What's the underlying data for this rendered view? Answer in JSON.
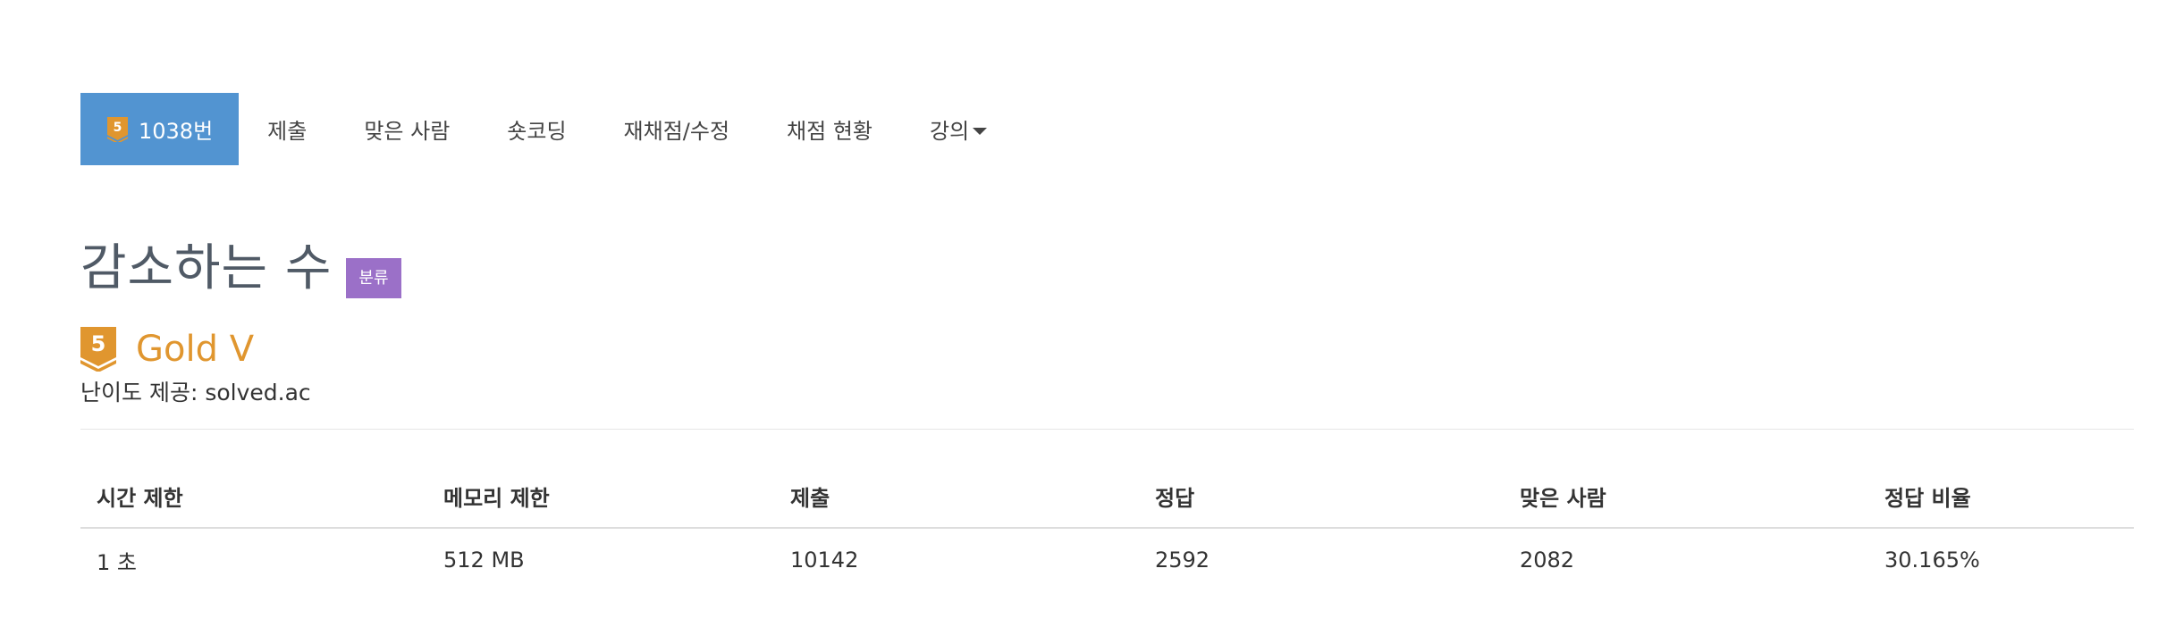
{
  "tabs": [
    {
      "label": "1038번",
      "active": true,
      "badge_tier": "5"
    },
    {
      "label": "제출"
    },
    {
      "label": "맞은 사람"
    },
    {
      "label": "숏코딩"
    },
    {
      "label": "재채점/수정"
    },
    {
      "label": "채점 현황"
    },
    {
      "label": "강의",
      "dropdown": true
    }
  ],
  "problem": {
    "title": "감소하는 수",
    "category_badge": "분류",
    "tier": {
      "level": "5",
      "name": "Gold V",
      "color": "#e0962f"
    },
    "provider": "난이도 제공: solved.ac"
  },
  "info_table": {
    "headers": [
      "시간 제한",
      "메모리 제한",
      "제출",
      "정답",
      "맞은 사람",
      "정답 비율"
    ],
    "row": [
      "1 초",
      "512 MB",
      "10142",
      "2592",
      "2082",
      "30.165%"
    ]
  },
  "colors": {
    "active_tab": "#5294d1",
    "category_badge": "#9b70c8",
    "gold": "#e0962f"
  },
  "icons": {
    "tab_tier": "gold-tier-5-icon",
    "tier": "gold-tier-5-icon",
    "dropdown": "caret-down-icon"
  }
}
